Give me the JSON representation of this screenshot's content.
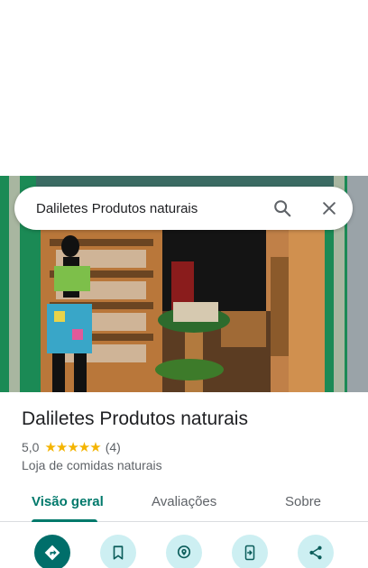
{
  "search": {
    "query": "Daliletes Produtos naturais"
  },
  "place": {
    "name": "Daliletes Produtos naturais",
    "rating": "5,0",
    "stars": "★★★★★",
    "review_count": "(4)",
    "category": "Loja de comidas naturais"
  },
  "tabs": [
    {
      "label": "Visão geral",
      "active": true
    },
    {
      "label": "Avaliações",
      "active": false
    },
    {
      "label": "Sobre",
      "active": false
    }
  ],
  "actions": [
    {
      "icon": "directions-icon"
    },
    {
      "icon": "bookmark-icon"
    },
    {
      "icon": "nearby-icon"
    },
    {
      "icon": "send-to-phone-icon"
    },
    {
      "icon": "share-icon"
    }
  ],
  "colors": {
    "accent": "#00796b",
    "action_bg": "#cdeff2",
    "primary_action": "#006e6a",
    "star": "#f4b400"
  }
}
